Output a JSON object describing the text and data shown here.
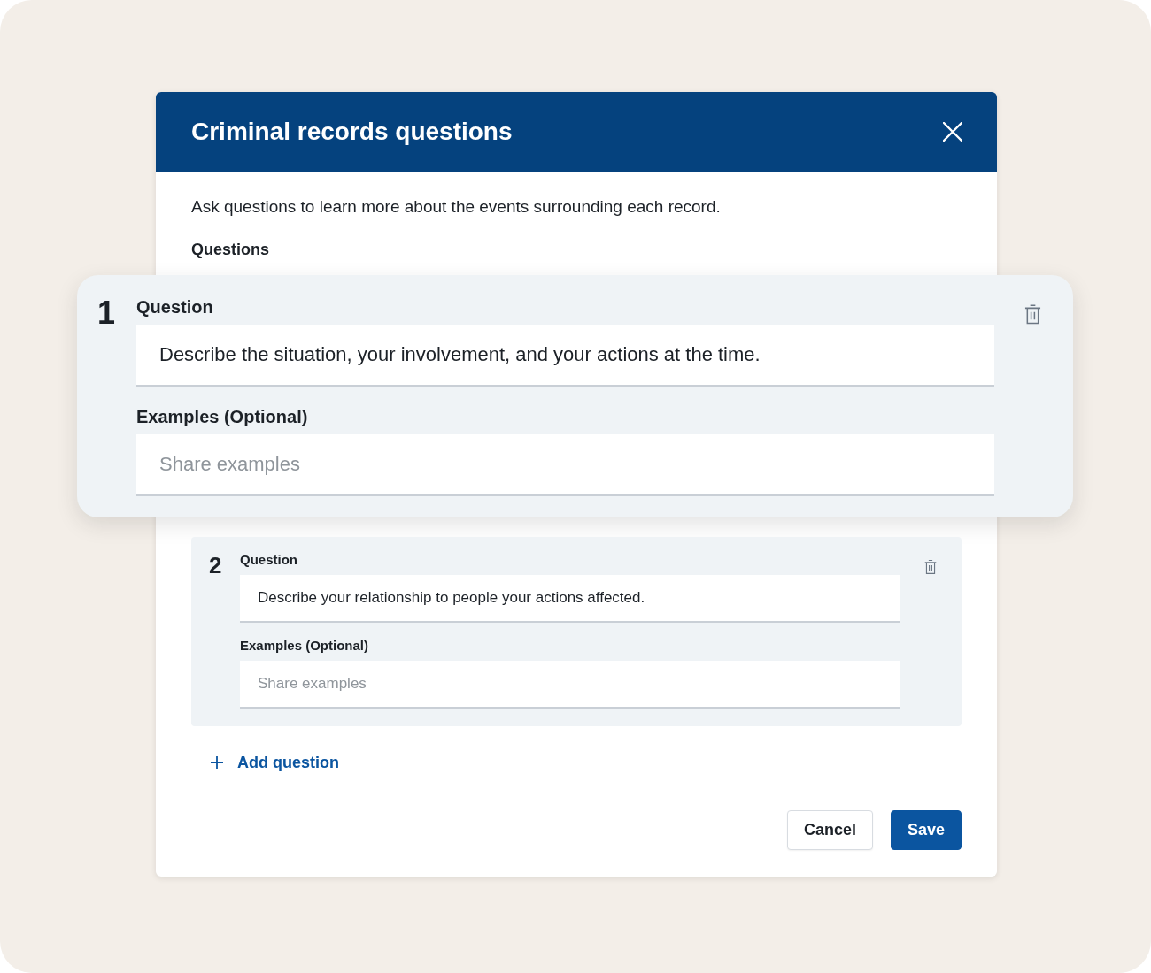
{
  "dialog": {
    "title": "Criminal records questions",
    "description": "Ask questions to learn more about the events surrounding each record.",
    "section_label": "Questions",
    "questions": [
      {
        "number": "1",
        "highlighted": true,
        "question": {
          "label": "Question",
          "value": "Describe the situation, your involvement, and your actions at the time."
        },
        "examples": {
          "label": "Examples (Optional)",
          "placeholder": "Share examples"
        }
      },
      {
        "number": "2",
        "highlighted": false,
        "question": {
          "label": "Question",
          "value": "Describe your relationship to people your actions affected."
        },
        "examples": {
          "label": "Examples (Optional)",
          "placeholder": "Share examples"
        }
      }
    ],
    "add_question": "Add question",
    "buttons": [
      {
        "label": "Cancel",
        "kind": "secondary"
      },
      {
        "label": "Save",
        "kind": "primary"
      }
    ]
  }
}
